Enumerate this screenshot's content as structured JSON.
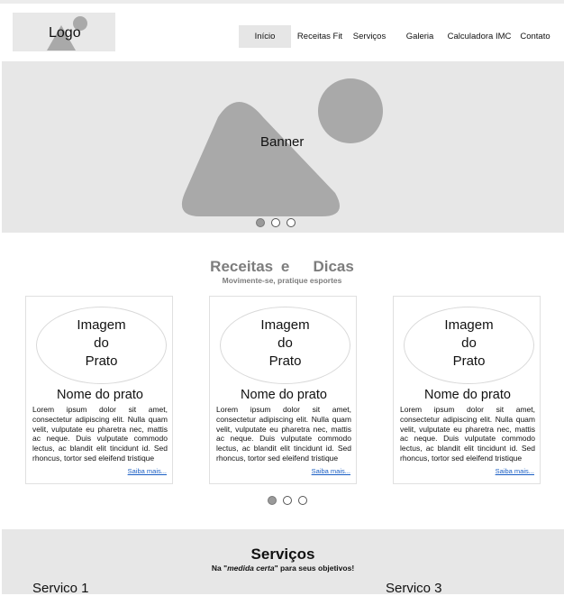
{
  "header": {
    "logo": "Logo",
    "nav": [
      {
        "label": "Início",
        "active": true
      },
      {
        "label": "Receitas Fit",
        "active": false
      },
      {
        "label": "Serviços",
        "active": false
      },
      {
        "label": "Galeria",
        "active": false
      },
      {
        "label": "Calculadora IMC",
        "active": false
      },
      {
        "label": "Contato",
        "active": false
      }
    ]
  },
  "banner": {
    "label": "Banner",
    "slide_count": 3,
    "active_slide": 1
  },
  "recipes": {
    "title": "Receitas e   Dicas",
    "subtitle": "Movimente-se, pratique esportes",
    "cards": [
      {
        "image_label": "Imagem\ndo\nPrato",
        "name": "Nome do prato",
        "text": "Lorem ipsum dolor sit amet, consectetur adipiscing elit. Nulla quam velit, vulputate eu pharetra nec, mattis ac neque. Duis vulputate commodo lectus, ac blandit elit tincidunt id. Sed rhoncus, tortor sed eleifend tristique",
        "more": "Saiba mais..."
      },
      {
        "image_label": "Imagem\ndo\nPrato",
        "name": "Nome do prato",
        "text": "Lorem ipsum dolor sit amet, consectetur adipiscing elit. Nulla quam velit, vulputate eu pharetra nec, mattis ac neque. Duis vulputate commodo lectus, ac blandit elit tincidunt id. Sed rhoncus, tortor sed eleifend tristique",
        "more": "Saiba mais..."
      },
      {
        "image_label": "Imagem\ndo\nPrato",
        "name": "Nome do prato",
        "text": "Lorem ipsum dolor sit amet, consectetur adipiscing elit. Nulla quam velit, vulputate eu pharetra nec, mattis ac neque. Duis vulputate commodo lectus, ac blandit elit tincidunt id. Sed rhoncus, tortor sed eleifend tristique",
        "more": "Saiba mais..."
      }
    ],
    "slide_count": 3,
    "active_slide": 1
  },
  "services": {
    "title": "Serviços",
    "subtitle_prefix": "Na \"",
    "subtitle_em": "medida certa",
    "subtitle_suffix": "\" para seus objetivos!",
    "items": [
      "Servico 1",
      "Servico 3"
    ]
  },
  "colors": {
    "placeholder_gray": "#e7e7e7",
    "shape_gray": "#a9a9a9",
    "link_blue": "#1a5ec4",
    "muted_title": "#7d7d7d"
  }
}
